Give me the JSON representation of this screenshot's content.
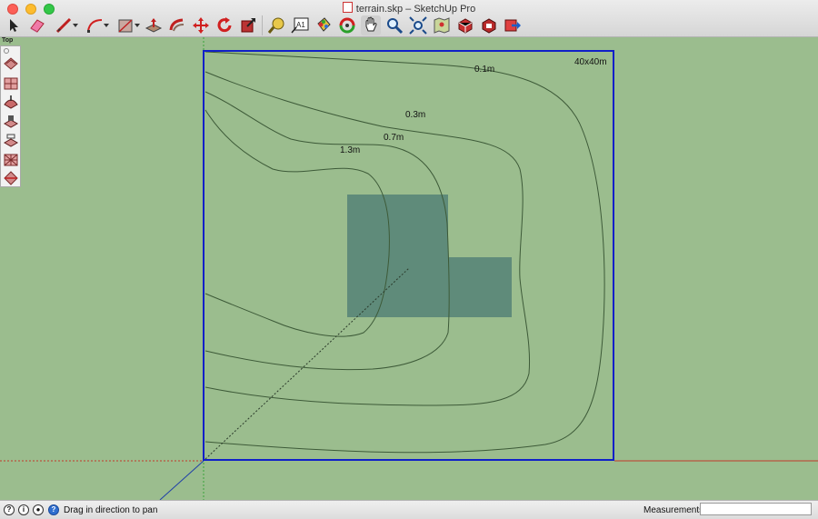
{
  "window": {
    "title": "terrain.skp – SketchUp Pro"
  },
  "toolbar": {
    "tools": [
      {
        "name": "select-tool-icon"
      },
      {
        "name": "eraser-tool-icon"
      },
      {
        "name": "line-tool-icon"
      },
      {
        "name": "arc-tool-icon"
      },
      {
        "name": "shapes-tool-icon"
      },
      {
        "name": "push-pull-tool-icon"
      },
      {
        "name": "follow-me-tool-icon"
      },
      {
        "name": "move-tool-icon"
      },
      {
        "name": "rotate-tool-icon"
      },
      {
        "name": "scale-tool-icon"
      },
      {
        "name": "tape-measure-tool-icon"
      },
      {
        "name": "text-tool-icon"
      },
      {
        "name": "paint-bucket-tool-icon"
      },
      {
        "name": "orbit-tool-icon"
      },
      {
        "name": "pan-tool-icon"
      },
      {
        "name": "zoom-tool-icon"
      },
      {
        "name": "zoom-extents-tool-icon"
      },
      {
        "name": "map-location-tool-icon"
      },
      {
        "name": "3d-warehouse-icon"
      },
      {
        "name": "extension-warehouse-icon"
      },
      {
        "name": "send-to-layout-icon"
      }
    ],
    "text_tool_label": "A1"
  },
  "palette": {
    "title": "Top",
    "tools": [
      "sandbox-from-contours-icon",
      "sandbox-from-scratch-icon",
      "smoove-icon",
      "stamp-icon",
      "drape-icon",
      "add-detail-icon",
      "flip-edge-icon"
    ]
  },
  "viewport": {
    "size_label": "40x40m",
    "contour_labels": [
      "0.1m",
      "0.3m",
      "0.7m",
      "1.3m"
    ],
    "colors": {
      "background": "#9bbd8e",
      "boundary": "#1020c8",
      "contour": "#3d5a38",
      "building": "#5f8b7a",
      "red_axis": "#c0392b",
      "green_axis": "#3aa33a",
      "blue_axis": "#1f3ea8"
    }
  },
  "statusbar": {
    "hint": "Drag in direction to pan",
    "measurements_label": "Measurements",
    "measurements_value": ""
  }
}
